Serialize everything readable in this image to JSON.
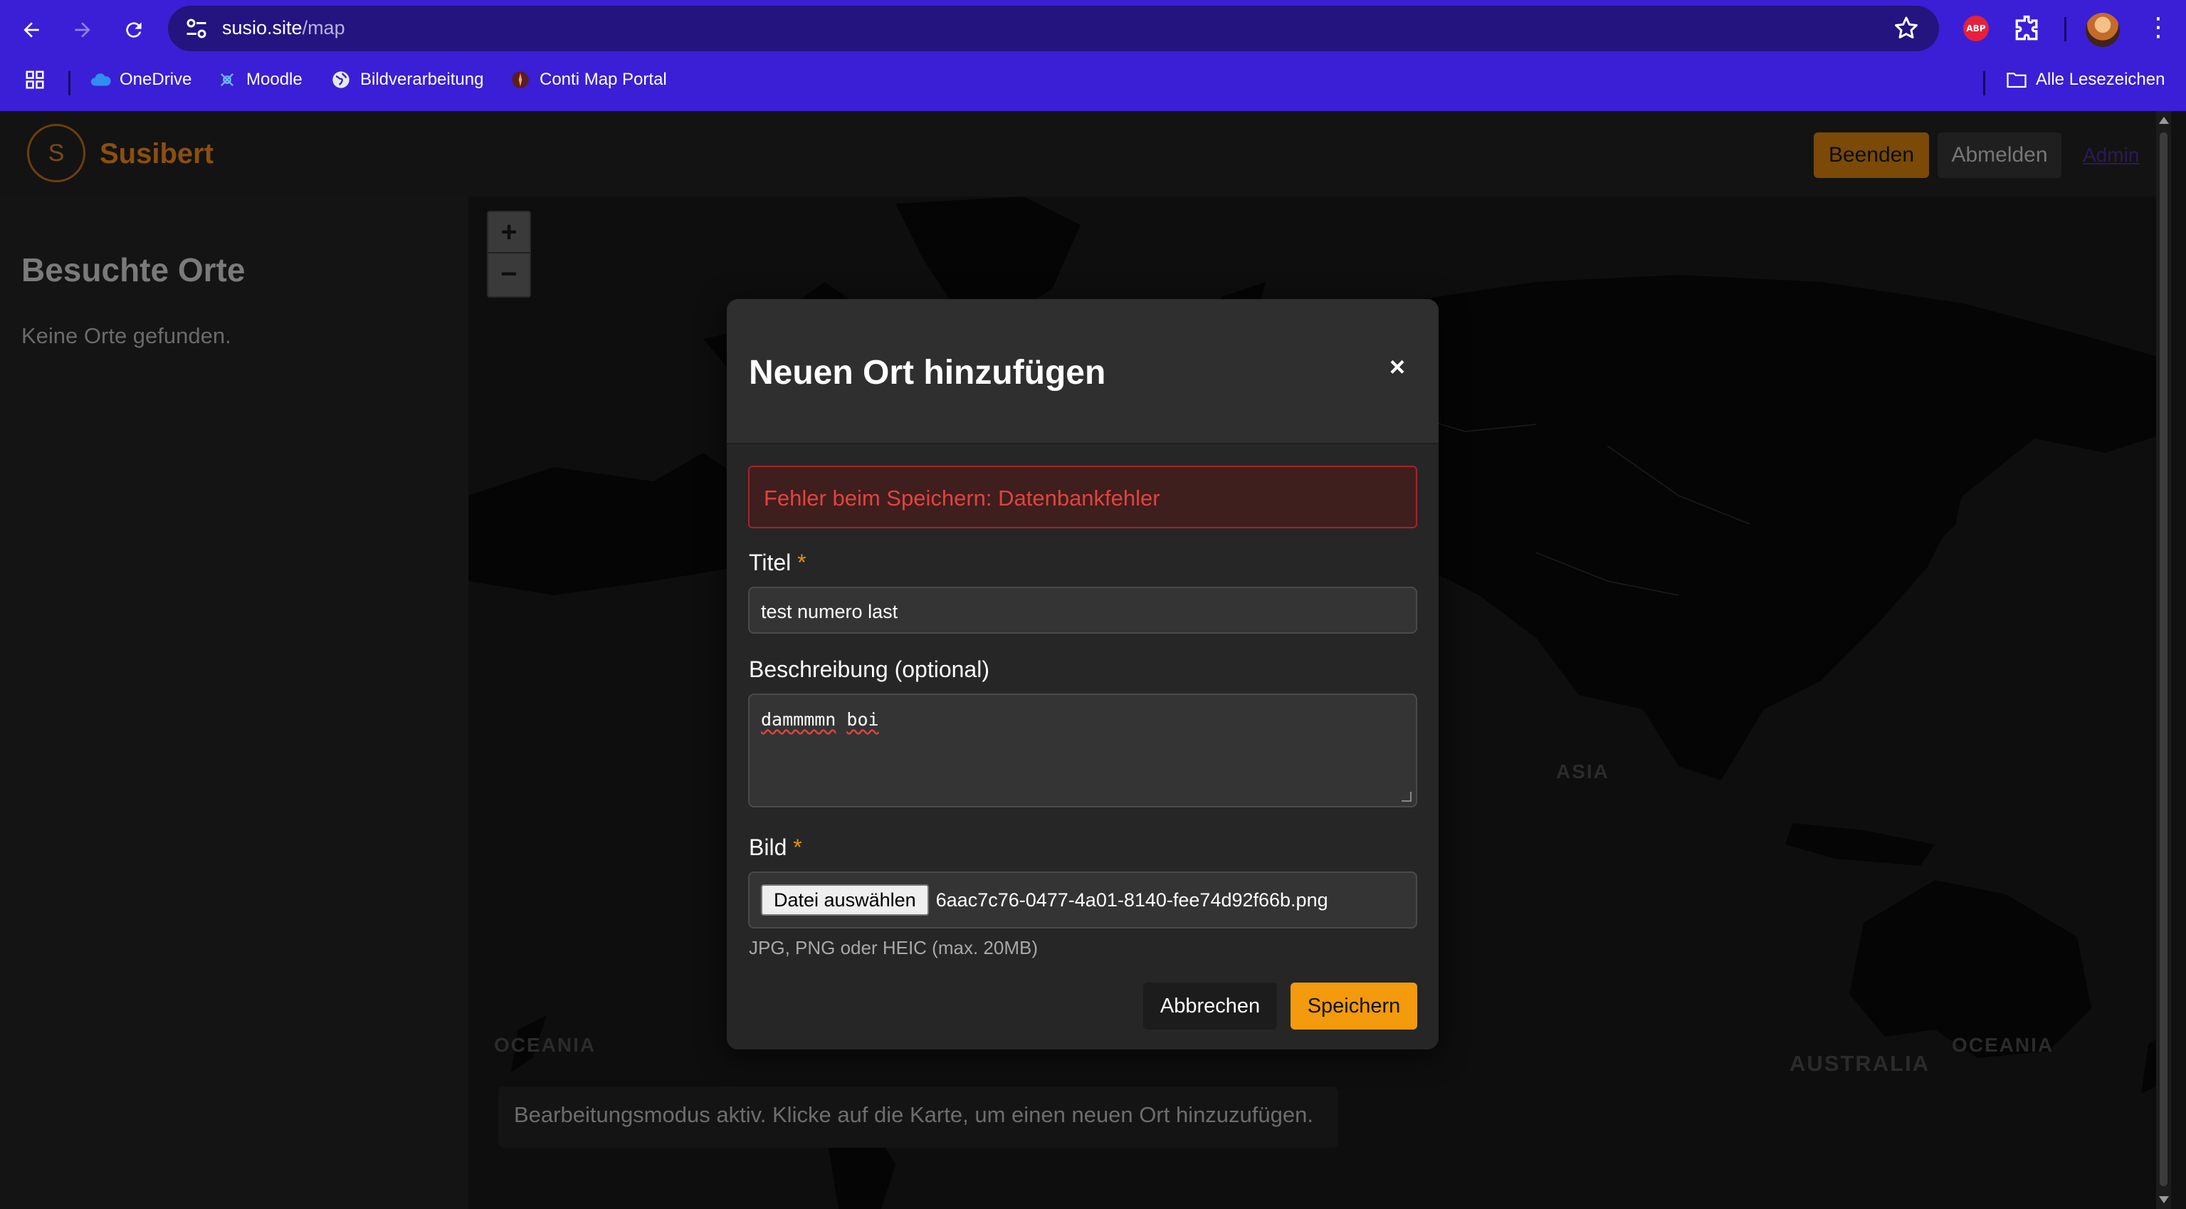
{
  "browser": {
    "url_host": "susio.site",
    "url_path": "/map",
    "accent_color": "#3a1fd6",
    "bookmarks": [
      {
        "label": "OneDrive",
        "icon": "cloud-icon"
      },
      {
        "label": "Moodle",
        "icon": "moodle-icon"
      },
      {
        "label": "Bildverarbeitung",
        "icon": "globe-icon"
      },
      {
        "label": "Conti Map Portal",
        "icon": "compass-icon"
      }
    ],
    "all_bookmarks_label": "Alle Lesezeichen",
    "abp_label": "ABP"
  },
  "app": {
    "logo_letter": "S",
    "brand": "Susibert",
    "brand_color": "#8a500f",
    "header_buttons": {
      "beenden": "Beenden",
      "abmelden": "Abmelden",
      "admin": "Admin"
    }
  },
  "sidebar": {
    "title": "Besuchte Orte",
    "empty_text": "Keine Orte gefunden."
  },
  "map": {
    "zoom_in": "+",
    "zoom_out": "−",
    "labels": {
      "asia": "ASIA",
      "oceania_left": "OCEANIA",
      "australia": "AUSTRALIA",
      "oceania_right": "OCEANIA"
    },
    "edit_hint": "Bearbeitungsmodus aktiv. Klicke auf die Karte, um einen neuen Ort hinzuzufügen."
  },
  "modal": {
    "title": "Neuen Ort hinzufügen",
    "close": "×",
    "error": "Fehler beim Speichern: Datenbankfehler",
    "title_label": "Titel",
    "title_value": "test numero last",
    "desc_label": "Beschreibung (optional)",
    "desc_word1": "dammmmn",
    "desc_word2": "boi",
    "image_label": "Bild",
    "required_mark": "*",
    "file_button": "Datei auswählen",
    "file_name": "6aac7c76-0477-4a01-8140-fee74d92f66b.png",
    "file_hint": "JPG, PNG oder HEIC (max. 20MB)",
    "cancel": "Abbrechen",
    "save": "Speichern",
    "save_color": "#f39a0d",
    "error_color": "#e0443d"
  }
}
